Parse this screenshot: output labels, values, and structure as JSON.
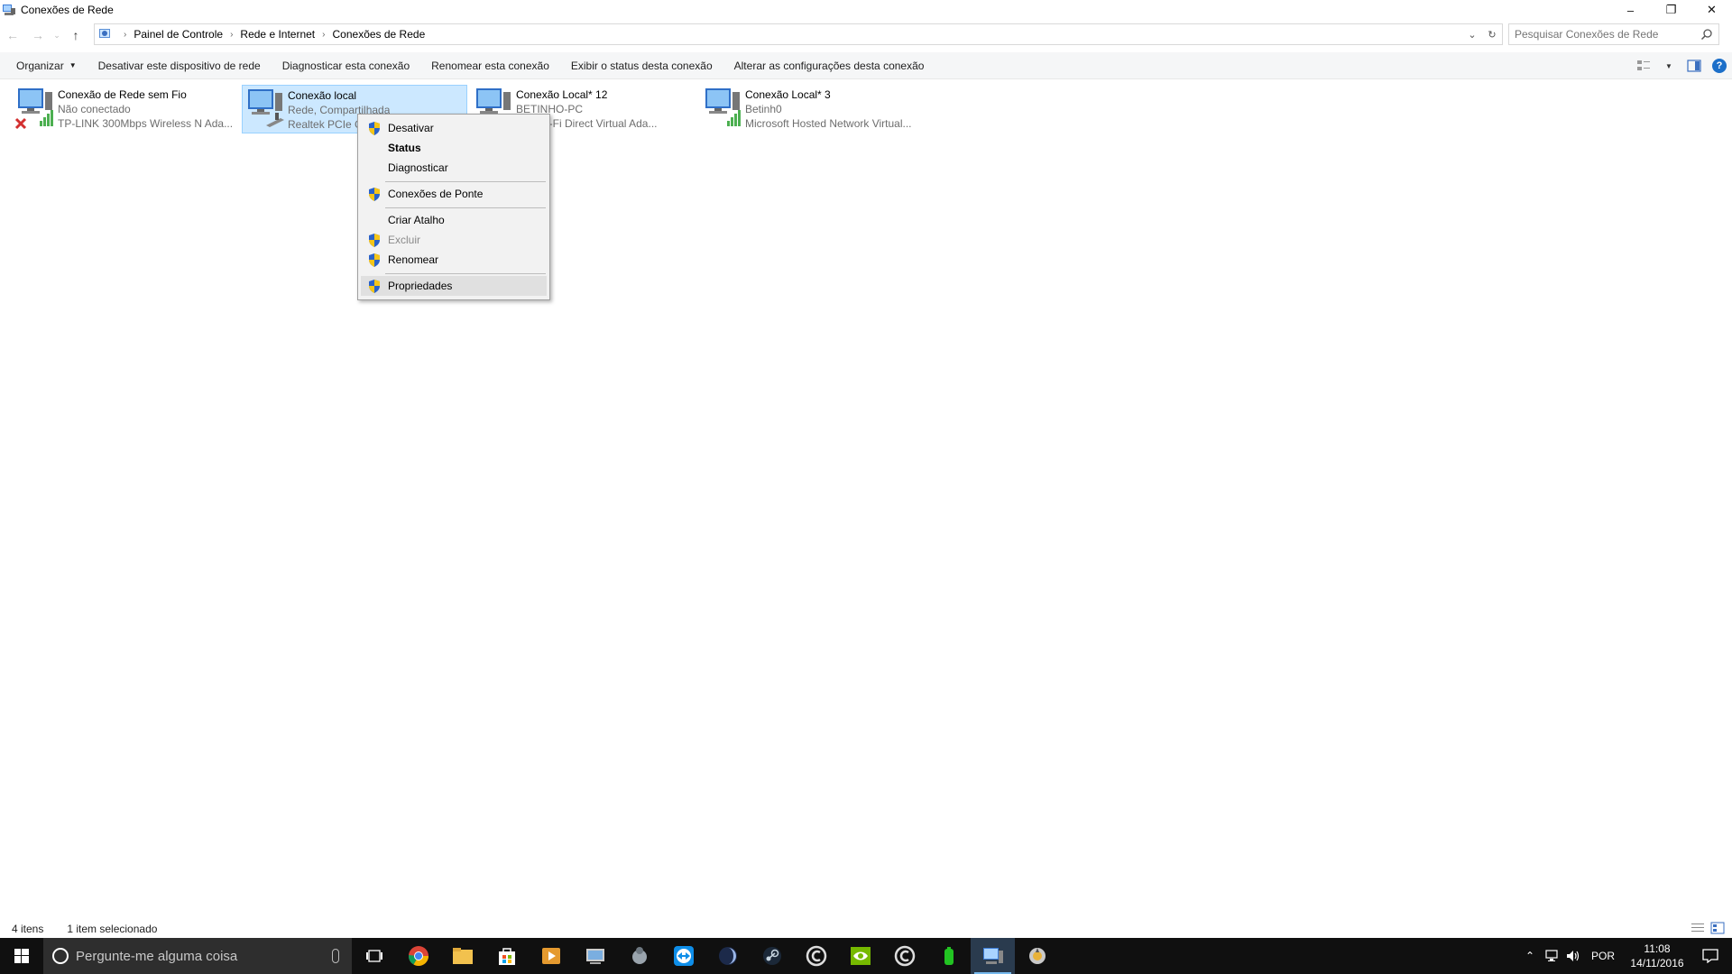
{
  "window": {
    "title": "Conexões de Rede",
    "minimize": "–",
    "restore": "❐",
    "close": "✕"
  },
  "address": {
    "breadcrumbs": [
      "Painel de Controle",
      "Rede e Internet",
      "Conexões de Rede"
    ],
    "search_placeholder": "Pesquisar Conexões de Rede"
  },
  "commands": {
    "organize": "Organizar",
    "disable_device": "Desativar este dispositivo de rede",
    "diagnose": "Diagnosticar esta conexão",
    "rename": "Renomear esta conexão",
    "view_status": "Exibir o status desta conexão",
    "change_settings": "Alterar as configurações desta conexão",
    "help": "?"
  },
  "connections": [
    {
      "name": "Conexão de Rede sem Fio",
      "status": "Não conectado",
      "adapter": "TP-LINK 300Mbps Wireless N Ada...",
      "selected": false
    },
    {
      "name": "Conexão local",
      "status": "Rede, Compartilhada",
      "adapter": "Realtek PCIe G",
      "selected": true
    },
    {
      "name": "Conexão Local* 12",
      "status": "BETINHO-PC",
      "adapter": "soft Wi-Fi Direct Virtual Ada...",
      "selected": false
    },
    {
      "name": "Conexão Local* 3",
      "status": "Betinh0",
      "adapter": "Microsoft Hosted Network Virtual...",
      "selected": false
    }
  ],
  "context_menu": {
    "items": [
      {
        "label": "Desativar",
        "shield": true,
        "bold": false,
        "disabled": false
      },
      {
        "label": "Status",
        "shield": false,
        "bold": true,
        "disabled": false
      },
      {
        "label": "Diagnosticar",
        "shield": false,
        "bold": false,
        "disabled": false
      },
      {
        "label": "Conexões de Ponte",
        "shield": true,
        "bold": false,
        "disabled": false
      },
      {
        "label": "Criar Atalho",
        "shield": false,
        "bold": false,
        "disabled": false
      },
      {
        "label": "Excluir",
        "shield": true,
        "bold": false,
        "disabled": true
      },
      {
        "label": "Renomear",
        "shield": true,
        "bold": false,
        "disabled": false
      },
      {
        "label": "Propriedades",
        "shield": true,
        "bold": false,
        "disabled": false,
        "highlighted": true
      }
    ]
  },
  "statusbar": {
    "item_count": "4 itens",
    "selection": "1 item selecionado"
  },
  "taskbar": {
    "search_placeholder": "Pergunte-me alguma coisa",
    "apps": [
      "task-view",
      "chrome",
      "file-explorer",
      "store",
      "media-player",
      "network-monitor",
      "bug-tool",
      "teamviewer",
      "flux",
      "steam",
      "ccleaner",
      "nvidia",
      "ccleaner-2",
      "battery-tool",
      "network-connections",
      "cpu-tool"
    ],
    "language": "POR",
    "time": "11:08",
    "date": "14/11/2016"
  },
  "colors": {
    "selection_bg": "#cce8ff",
    "taskbar_bg": "#101010",
    "shield_blue": "#2a62c9",
    "shield_yellow": "#f5c518"
  }
}
